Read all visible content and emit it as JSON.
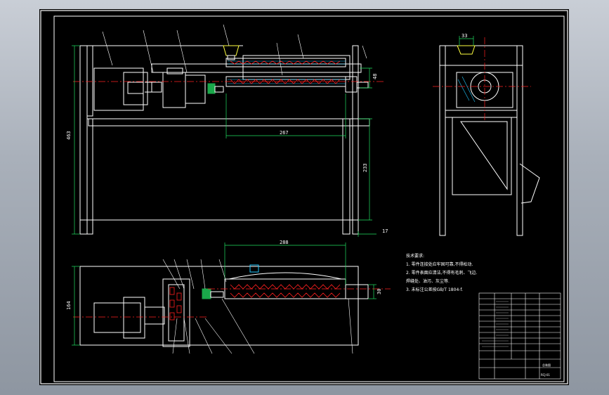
{
  "drawing": {
    "dimensions": {
      "front_height": "463",
      "front_shaft_len": "267",
      "front_frame_h": "233",
      "front_small": "17",
      "front_right": "48",
      "top_len": "288",
      "top_height": "164",
      "top_right": "30",
      "side_top": "33"
    },
    "notes": {
      "title": "技术要求:",
      "lines": [
        "1. 零件连接处应牢固可靠,不得松动.",
        "2. 零件表面应清洁,不得有毛刺、飞边.",
        "   焊缝处、油污、灰尘等.",
        "3. 未标注公差按GB/T 1804-f."
      ]
    },
    "title_block": {
      "drawing_name": "总装图",
      "drawing_code": "RCJ-01"
    },
    "colors": {
      "line": "#ffffff",
      "centerline": "#ff2020",
      "dimension": "#20e060",
      "hatch": "#20c8ff",
      "accent": "#ffff40",
      "frame": "#ffffff"
    }
  }
}
